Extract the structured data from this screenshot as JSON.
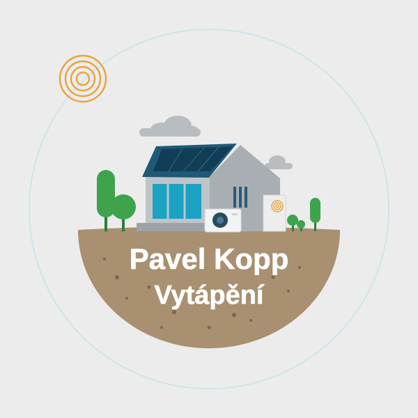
{
  "logo": {
    "line1": "Pavel Kopp",
    "line2": "Vytápění"
  },
  "colors": {
    "background": "#ececec",
    "ring": "#cfe5ea",
    "soil": "#a89070",
    "sun": "#e8a33a",
    "house_wall": "#bfc4c8",
    "house_side": "#a9aeb3",
    "roof": "#1e5a78",
    "solar_panel": "#123e55",
    "window": "#1aa3c2",
    "tree": "#3fa34d",
    "cloud": "#b9bdc0"
  },
  "icons": [
    "sun-icon",
    "cloud-icon",
    "house-icon",
    "solar-panel-icon",
    "heat-pump-icon",
    "boiler-icon",
    "tree-icon"
  ]
}
